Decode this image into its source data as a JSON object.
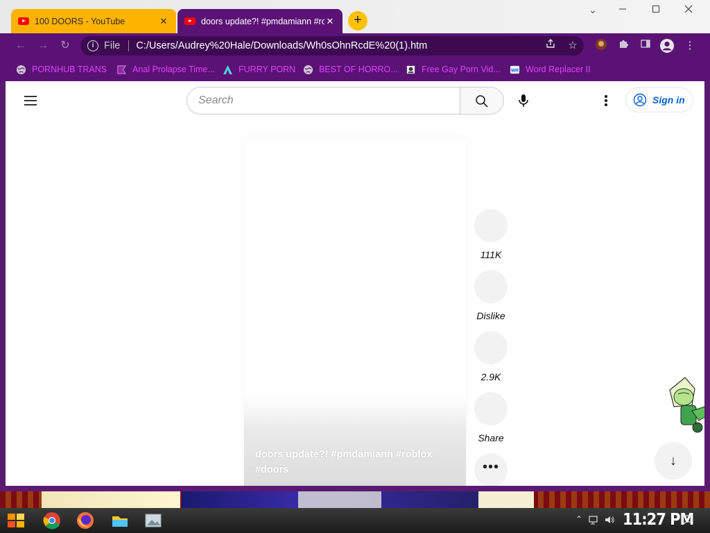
{
  "browser": {
    "tabs": [
      {
        "title": "100 DOORS - YouTube",
        "active": false
      },
      {
        "title": "doors update?! #pmdamiann #roblox #doors",
        "active": true
      }
    ],
    "new_tab_label": "+",
    "address": {
      "scheme": "File",
      "url": "C:/Users/Audrey%20Hale/Downloads/Wh0sOhnRcdE%20(1).htm"
    },
    "bookmarks": [
      {
        "label": "PORNHUB TRANS",
        "icon": "globe-icon"
      },
      {
        "label": "Anal Prolapse Time...",
        "icon": "purple-bookmark-icon"
      },
      {
        "label": "FURRY PORN",
        "icon": "triangle-logo-icon"
      },
      {
        "label": "BEST OF HORRO...",
        "icon": "globe-icon"
      },
      {
        "label": "Free Gay Porn Vid...",
        "icon": "site-favicon-icon"
      },
      {
        "label": "Word Replacer II",
        "icon": "extension-icon"
      }
    ],
    "colors": {
      "theme": "#5b1275",
      "active_tab": "#5b1275",
      "inactive_tab": "#ffb300",
      "bookmark_text": "#e040fb"
    }
  },
  "youtube": {
    "search_placeholder": "Search",
    "sign_in_label": "Sign in",
    "short": {
      "caption": "doors update?! #pmdamiann #roblox #doors"
    },
    "actions": [
      {
        "name": "like",
        "label": "111K"
      },
      {
        "name": "dislike",
        "label": "Dislike"
      },
      {
        "name": "comments",
        "label": "2.9K"
      },
      {
        "name": "share",
        "label": "Share"
      }
    ],
    "more_label": "•••",
    "nav_down_label": "↓"
  },
  "taskbar": {
    "clock": "11:27 PM"
  }
}
